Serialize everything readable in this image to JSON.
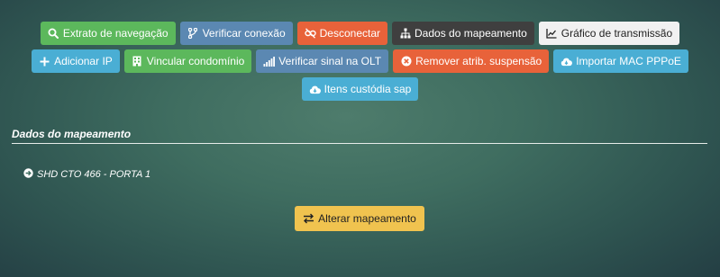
{
  "toolbar": {
    "row1": {
      "extrato": "Extrato de navegação",
      "verificar_conexao": "Verificar conexão",
      "desconectar": "Desconectar",
      "dados_mapeamento": "Dados do mapeamento",
      "grafico": "Gráfico de transmissão"
    },
    "row2": {
      "adicionar_ip": "Adicionar IP",
      "vincular": "Vincular condomínio",
      "verificar_sinal": "Verificar sinal na OLT",
      "remover": "Remover atrib. suspensão",
      "importar_mac": "Importar MAC PPPoE"
    },
    "row3": {
      "itens_custodia": "Itens custódia sap"
    }
  },
  "section": {
    "title": "Dados do mapeamento",
    "item": "SHD CTO 466 - PORTA 1",
    "alter_button": "Alterar mapeamento"
  },
  "icons": {
    "extrato": "search-icon",
    "verificar_conexao": "branch-icon",
    "desconectar": "unlink-icon",
    "dados_mapeamento": "sitemap-icon",
    "grafico": "line-chart-icon",
    "adicionar_ip": "plus-icon",
    "vincular": "building-icon",
    "verificar_sinal": "signal-icon",
    "remover": "close-circle-icon",
    "importar_mac": "cloud-download-icon",
    "itens_custodia": "cloud-download-icon",
    "map_item": "arrow-circle-right-icon",
    "alter": "exchange-icon"
  },
  "colors": {
    "green": "#5cb85c",
    "blue": "#5b88b2",
    "orange": "#e8623a",
    "dark": "#3f3f3f",
    "light": "#f1f1f1",
    "sky": "#4aaed4",
    "yellow": "#f0c34f"
  }
}
